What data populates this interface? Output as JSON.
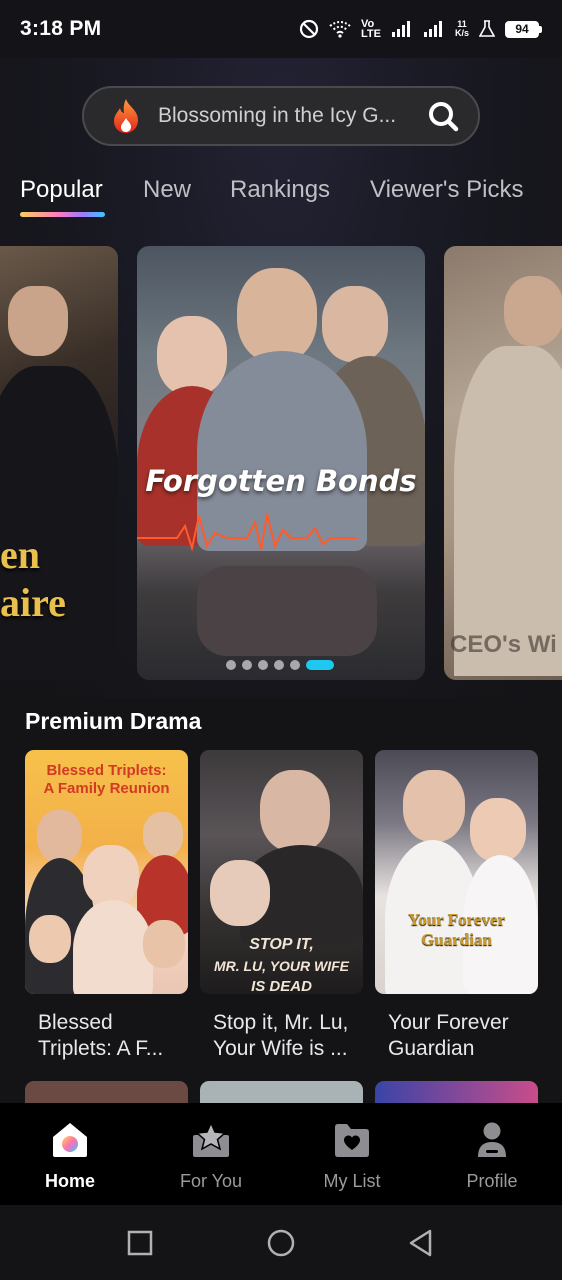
{
  "status_bar": {
    "time": "3:18 PM",
    "lte_top": "Vo",
    "lte_bottom": "LTE",
    "net_speed_value": "11",
    "net_speed_unit": "K/s",
    "battery": "94"
  },
  "search": {
    "text": "Blossoming in the Icy G..."
  },
  "tabs": [
    {
      "label": "Popular",
      "active": true
    },
    {
      "label": "New"
    },
    {
      "label": "Rankings"
    },
    {
      "label": "Viewer's Picks"
    }
  ],
  "carousel": {
    "left_card_text_1": "en",
    "left_card_text_2": "aire",
    "main_title": "Forgotten Bonds",
    "right_card_text": "CEO's Wi",
    "dots_total": 6,
    "active_dot": 6
  },
  "premium": {
    "title": "Premium Drama",
    "items": [
      {
        "label": "Blessed Triplets: A F...",
        "poster_text_1": "Blessed Triplets:",
        "poster_text_2": "A Family Reunion"
      },
      {
        "label": "Stop it, Mr. Lu, Your Wife is ...",
        "poster_text_1": "STOP IT,",
        "poster_text_2": "MR. LU, YOUR WIFE",
        "poster_text_3": "IS DEAD"
      },
      {
        "label": "Your Forever Guardian",
        "poster_text_1": "Your Forever",
        "poster_text_2": "Guardian"
      }
    ]
  },
  "bottom_nav": [
    {
      "label": "Home",
      "icon": "home-icon",
      "active": true
    },
    {
      "label": "For You",
      "icon": "star-icon"
    },
    {
      "label": "My List",
      "icon": "folder-heart-icon"
    },
    {
      "label": "Profile",
      "icon": "person-icon"
    }
  ],
  "colors": {
    "accent": "#1ec8f0",
    "background": "#141416",
    "nav_background": "#000000"
  }
}
